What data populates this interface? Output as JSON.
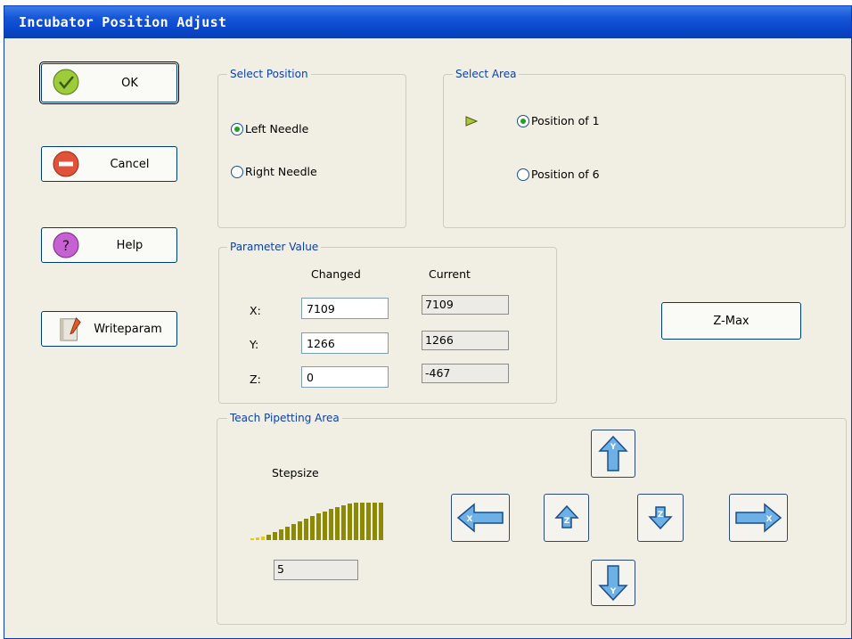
{
  "window": {
    "title": "Incubator Position Adjust"
  },
  "buttons": {
    "ok": "OK",
    "cancel": "Cancel",
    "help": "Help",
    "writeparam": "Writeparam",
    "zmax": "Z-Max"
  },
  "select_position": {
    "title": "Select Position",
    "options": [
      {
        "label": "Left Needle",
        "selected": true
      },
      {
        "label": "Right Needle",
        "selected": false
      }
    ]
  },
  "select_area": {
    "title": "Select Area",
    "options": [
      {
        "label": "Position of 1",
        "selected": true
      },
      {
        "label": "Position of 6",
        "selected": false
      }
    ]
  },
  "parameter_value": {
    "title": "Parameter Value",
    "col_changed": "Changed",
    "col_current": "Current",
    "rows": [
      {
        "label": "X:",
        "changed": "7109",
        "current": "7109"
      },
      {
        "label": "Y:",
        "changed": "1266",
        "current": "1266"
      },
      {
        "label": "Z:",
        "changed": "0",
        "current": "-467"
      }
    ]
  },
  "teach": {
    "title": "Teach Pipetting Area",
    "stepsize_label": "Stepsize",
    "stepsize_value": "5",
    "arrow_labels": {
      "y_up": "Y",
      "y_down": "Y",
      "x_left": "X",
      "x_right": "X",
      "z_up": "Z",
      "z_down": "Z"
    }
  },
  "colors": {
    "titlebar": "#0a47cb",
    "group_title": "#0a3fb0",
    "arrow_fill": "#5fa8e0",
    "stepsize_bar": "#8b8a00",
    "stepsize_small": "#f0c800"
  }
}
